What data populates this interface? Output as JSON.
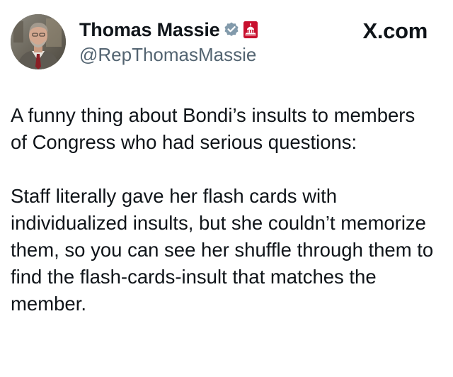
{
  "author": {
    "display_name": "Thomas Massie",
    "handle": "@RepThomasMassie",
    "avatar_icon": "profile-photo",
    "verified_badge_icon": "verified-checkmark-icon",
    "affiliation_badge_icon": "us-capitol-badge-icon",
    "verified_badge_color": "#829aab",
    "affiliation_badge_color": "#c8102e"
  },
  "source": {
    "label": "X.com"
  },
  "post": {
    "paragraphs": [
      "A funny thing about Bondi’s insults to members of Congress who had serious questions:",
      "Staff literally gave her flash cards with individualized insults, but she couldn’t memorize them, so you can see her shuffle through them to find the flash-cards-insult that matches the member."
    ]
  }
}
